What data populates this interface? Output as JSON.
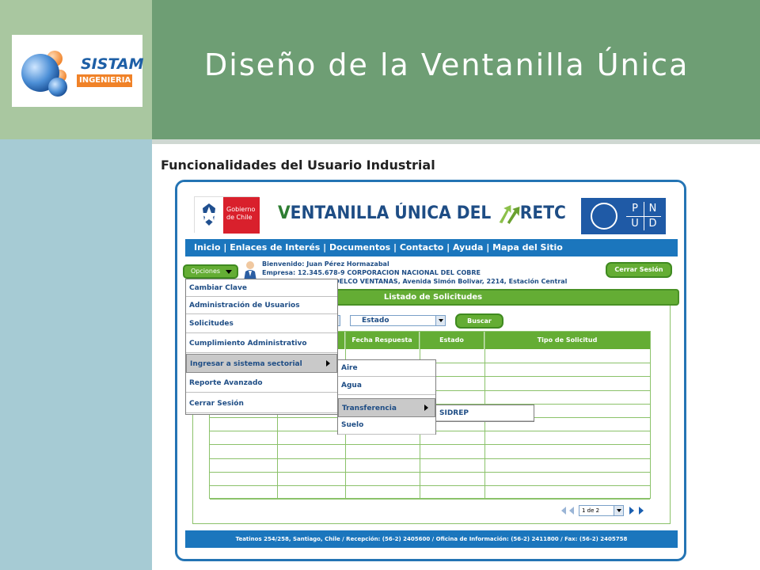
{
  "slide": {
    "title": "Diseño de la Ventanilla Única",
    "subtitle": "Funcionalidades del Usuario Industrial",
    "logo": {
      "brand": "SISTAM",
      "tagline": "INGENIERIA",
      "colors": {
        "blue": "#1d5fa6",
        "orange": "#f08228"
      }
    },
    "colors": {
      "title_band": "#6e9e74",
      "left_top": "#a9c7a0",
      "left_bottom": "#a6cbd4"
    }
  },
  "app": {
    "gob_logo": {
      "line1": "Gobierno",
      "line2": "de Chile"
    },
    "brand_title": "VENTANILLA ÚNICA DEL RETC",
    "brand_first_letter": "V",
    "brand_rest": "ENTANILLA ÚNICA DEL",
    "brand_retc": "RETC",
    "pnud": [
      "P",
      "N",
      "U",
      "D"
    ],
    "nav": "Inicio | Enlaces de Interés | Documentos | Contacto | Ayuda | Mapa del Sitio",
    "opciones_label": "Opciones",
    "user": {
      "welcome": "Bienvenido: Juan Pérez Hormazabal",
      "empresa": "Empresa: 12.345.678-9 CORPORACION NACIONAL DEL COBRE",
      "establecimiento": "Establecimiento: CODELCO VENTANAS, Avenida Simón Bolivar, 2214, Estación Central"
    },
    "cerrar_sesion_button": "Cerrar Sesión",
    "listado_title": "Listado de Solicitudes",
    "estado_select": "Estado",
    "buscar_button": "Buscar",
    "grid_headers": [
      "",
      "",
      "Fecha Respuesta",
      "Estado",
      "Tipo de Solicitud"
    ],
    "grid_row_count": 11,
    "pager_select": "1 de 2",
    "footer": "Teatinos 254/258, Santiago, Chile / Recepción: (56-2) 2405600 / Oficina de Información: (56-2) 2411800 / Fax: (56-2) 2405758",
    "menu": {
      "items": [
        {
          "label": "Cambiar Clave"
        },
        {
          "label": "Administración de Usuarios"
        },
        {
          "label": "Solicitudes"
        },
        {
          "label": "Cumplimiento Administrativo"
        },
        {
          "label": "Ingresar a sistema sectorial",
          "active": true,
          "has_submenu": true
        },
        {
          "label": "Reporte Avanzado"
        },
        {
          "label": "Cerrar Sesión"
        }
      ],
      "submenu": [
        {
          "label": "Aire"
        },
        {
          "label": "Agua"
        },
        {
          "label": "Transferencia",
          "active": true,
          "has_submenu": true
        },
        {
          "label": "Suelo"
        }
      ],
      "subsubmenu": [
        {
          "label": "SIDREP"
        }
      ]
    },
    "colors": {
      "nav_blue": "#1b76bd",
      "green": "#64ad34",
      "frame": "#2474b4",
      "menu_text": "#1e4d85"
    }
  }
}
